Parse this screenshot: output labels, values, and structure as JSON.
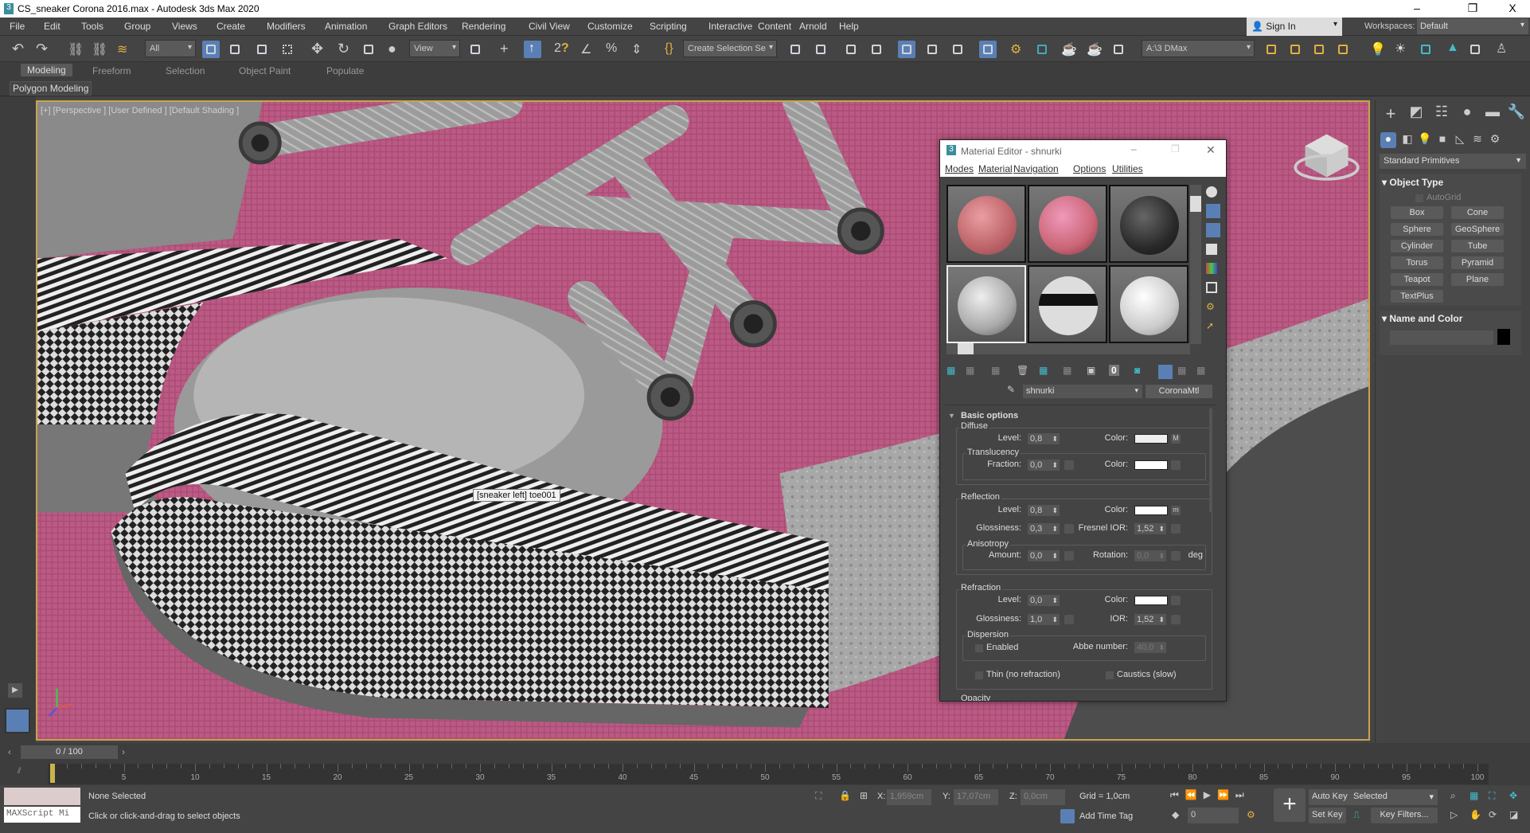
{
  "title": {
    "text": "CS_sneaker Corona 2016.max - Autodesk 3ds Max 2020",
    "minimize": "–",
    "maximize": "❐",
    "close": "X"
  },
  "menu": [
    "File",
    "Edit",
    "Tools",
    "Group",
    "Views",
    "Create",
    "Modifiers",
    "Animation",
    "Graph Editors",
    "Rendering",
    "Civil View",
    "Customize",
    "Scripting",
    "Interactive",
    "Content",
    "Arnold",
    "Help"
  ],
  "account": {
    "sign_in": "Sign In",
    "workspaces_label": "Workspaces:",
    "workspace": "Default"
  },
  "toolbar": {
    "filter": "All",
    "ref_coord": "View",
    "selection_set": "Create Selection Se",
    "scene": "A:\\3 DMax"
  },
  "ribbon": {
    "tabs": [
      "Modeling",
      "Freeform",
      "Selection",
      "Object Paint",
      "Populate"
    ],
    "sub": "Polygon Modeling"
  },
  "viewport": {
    "label": "[+] [Perspective ] [User Defined ] [Default Shading ]",
    "tooltip": "[sneaker left] toe001"
  },
  "material_editor": {
    "title": "Material Editor - shnurki",
    "menu": [
      "Modes",
      "Material",
      "Navigation",
      "Options",
      "Utilities"
    ],
    "material_name": "shnurki",
    "material_type": "CoronaMtl",
    "rollout": "Basic options",
    "diffuse": {
      "title": "Diffuse",
      "level_label": "Level:",
      "level": "0,8",
      "color_label": "Color:",
      "map": "M",
      "translucency": {
        "title": "Translucency",
        "fraction_label": "Fraction:",
        "fraction": "0,0",
        "color_label": "Color:"
      }
    },
    "reflection": {
      "title": "Reflection",
      "level_label": "Level:",
      "level": "0,8",
      "color_label": "Color:",
      "map": "m",
      "gloss_label": "Glossiness:",
      "gloss": "0,3",
      "fresnel_label": "Fresnel IOR:",
      "fresnel": "1,52",
      "anisotropy": {
        "title": "Anisotropy",
        "amount_label": "Amount:",
        "amount": "0,0",
        "rotation_label": "Rotation:",
        "rotation": "0,0",
        "unit": "deg"
      }
    },
    "refraction": {
      "title": "Refraction",
      "level_label": "Level:",
      "level": "0,0",
      "color_label": "Color:",
      "gloss_label": "Glossiness:",
      "gloss": "1,0",
      "ior_label": "IOR:",
      "ior": "1,52",
      "dispersion": {
        "title": "Dispersion",
        "enabled": "Enabled",
        "abbe_label": "Abbe number:",
        "abbe": "40,0"
      },
      "thin": "Thin (no refraction)",
      "caustics": "Caustics (slow)"
    },
    "opacity": "Opacity"
  },
  "command_panel": {
    "dropdown": "Standard Primitives",
    "object_type": "Object Type",
    "autogrid": "AutoGrid",
    "buttons": [
      "Box",
      "Cone",
      "Sphere",
      "GeoSphere",
      "Cylinder",
      "Tube",
      "Torus",
      "Pyramid",
      "Teapot",
      "Plane",
      "TextPlus"
    ],
    "name_color": "Name and Color",
    "object_color": "#000000"
  },
  "timeline": {
    "frame": "0 / 100",
    "ticks": [
      "5",
      "10",
      "15",
      "20",
      "25",
      "30",
      "35",
      "40",
      "45",
      "50",
      "55",
      "60",
      "65",
      "70",
      "75",
      "80",
      "85",
      "90",
      "95",
      "100"
    ],
    "progress": 0
  },
  "status": {
    "maxscript": "MAXScript Mi",
    "selection": "None Selected",
    "prompt": "Click or click-and-drag to select objects",
    "x_label": "X:",
    "x": "1,959cm",
    "y_label": "Y:",
    "y": "17,07cm",
    "z_label": "Z:",
    "z": "0,0cm",
    "grid": "Grid = 1,0cm",
    "add_time_tag": "Add Time Tag",
    "auto_key": "Auto Key",
    "set_key": "Set Key",
    "key_mode": "Selected",
    "key_filters": "Key Filters...",
    "current_frame": "0"
  },
  "colors": {
    "accent": "#5a7fb5",
    "pink": "#b9567f",
    "viewport_border": "#c9a44d"
  }
}
